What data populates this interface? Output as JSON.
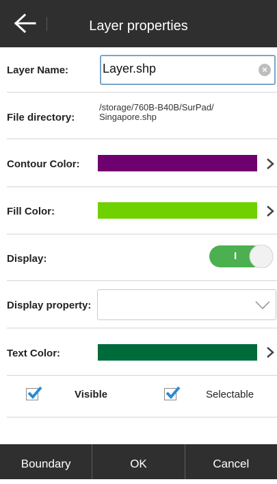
{
  "header": {
    "title": "Layer properties",
    "back_icon": "arrow-left-icon"
  },
  "layer_name": {
    "label": "Layer Name:",
    "value": "Layer.shp"
  },
  "file_directory": {
    "label": "File directory:",
    "path_line1": "/storage/760B-B40B/SurPad/",
    "path_line2": "Singapore.shp"
  },
  "contour_color": {
    "label": "Contour Color:",
    "color": "#6e006f"
  },
  "fill_color": {
    "label": "Fill Color:",
    "color": "#6fd100"
  },
  "display": {
    "label": "Display:",
    "on": true,
    "toggle_glyph": "I"
  },
  "display_property": {
    "label": "Display property:",
    "value": ""
  },
  "text_color": {
    "label": "Text Color:",
    "color": "#006b3a"
  },
  "checks": {
    "visible": {
      "label": "Visible",
      "checked": true
    },
    "selectable": {
      "label": "Selectable",
      "checked": true
    }
  },
  "footer": {
    "boundary": "Boundary",
    "ok": "OK",
    "cancel": "Cancel"
  },
  "colors": {
    "header_bg": "#2f2f2f",
    "toggle_green": "#4caf50",
    "check_blue": "#2a8ad4"
  }
}
